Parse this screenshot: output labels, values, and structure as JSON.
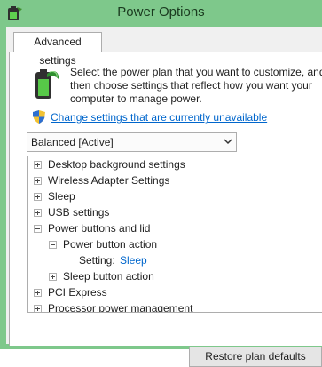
{
  "window": {
    "title": "Power Options",
    "icon": "power-options-icon",
    "frame_color": "#7ec88b"
  },
  "tabs": [
    {
      "label": "Advanced settings",
      "active": true
    }
  ],
  "description": "Select the power plan that you want to customize, and\nthen choose settings that reflect how you want your\ncomputer to manage power.",
  "change_link": "Change settings that are currently unavailable",
  "plan_select": {
    "value": "Balanced [Active]"
  },
  "tree": {
    "desktop_background": "Desktop background settings",
    "wireless_adapter": "Wireless Adapter Settings",
    "sleep": "Sleep",
    "usb": "USB settings",
    "power_buttons": "Power buttons and lid",
    "power_button_action": "Power button action",
    "setting_label": "Setting:",
    "setting_value": "Sleep",
    "sleep_button_action": "Sleep button action",
    "pci_express": "PCI Express",
    "processor": "Processor power management"
  },
  "restore_button": "Restore plan defaults",
  "colors": {
    "link": "#0066cc",
    "accent": "#7ec88b"
  }
}
